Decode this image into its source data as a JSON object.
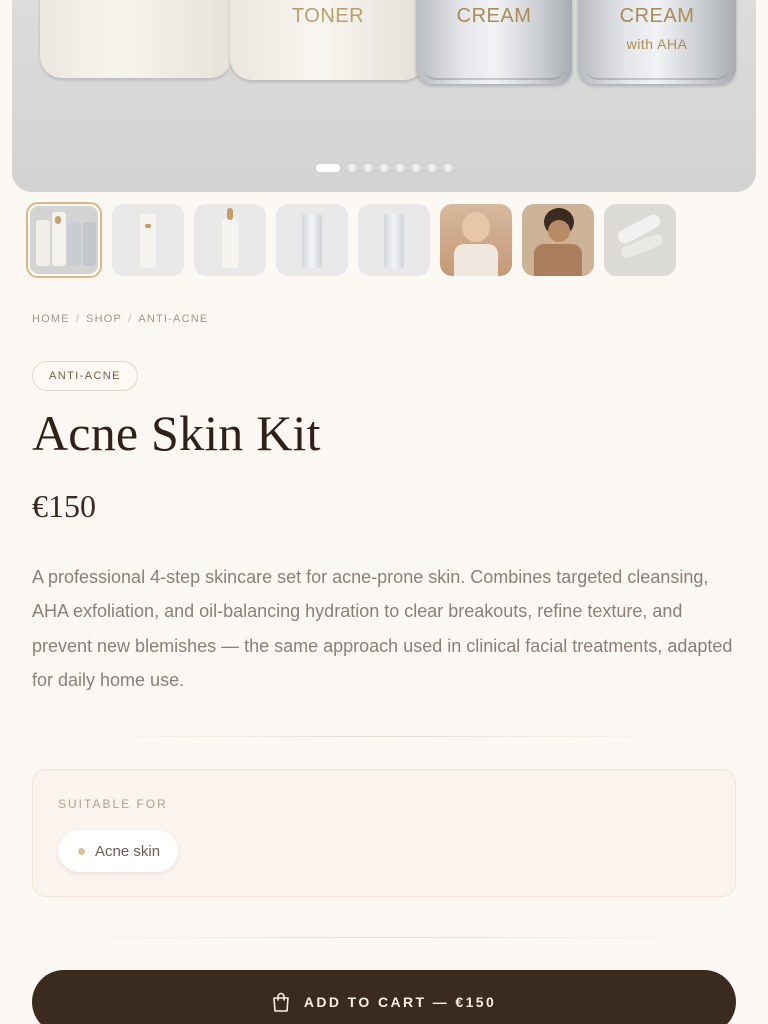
{
  "hero": {
    "bottles": [
      {
        "label": ""
      },
      {
        "label": "TONER"
      },
      {
        "label": "CREAM"
      },
      {
        "label": "CREAM",
        "sublabel": "with AHA"
      }
    ],
    "slides_total": 8,
    "active_slide": 1
  },
  "thumbnails": [
    {
      "icon": "kit-group-thumb",
      "selected": true
    },
    {
      "icon": "bottle-thumb"
    },
    {
      "icon": "pump-bottle-thumb"
    },
    {
      "icon": "silver-bottle-thumb"
    },
    {
      "icon": "silver-bottle-thumb"
    },
    {
      "icon": "woman-applying-thumb"
    },
    {
      "icon": "woman-smiling-thumb"
    },
    {
      "icon": "cream-swatch-thumb"
    }
  ],
  "breadcrumb": {
    "home": "HOME",
    "shop": "SHOP",
    "current": "ANTI-ACNE",
    "sep": "/"
  },
  "product": {
    "category_tag": "ANTI-ACNE",
    "title": "Acne Skin Kit",
    "price": "€150",
    "description": "A professional 4-step skincare set for acne-prone skin. Combines targeted cleansing, AHA exfoliation, and oil-balancing hydration to clear breakouts, refine texture, and prevent new blemishes — the same approach used in clinical facial treatments, adapted for daily home use."
  },
  "suitable": {
    "title": "SUITABLE FOR",
    "items": [
      "Acne skin"
    ]
  },
  "cart": {
    "label": "ADD TO CART — €150",
    "icon": "shopping-bag-icon"
  },
  "colors": {
    "background": "#fcf9f5",
    "accent_dark": "#3b2a1f",
    "selected_border": "#d7b98a",
    "card": "#fbf3ed"
  }
}
